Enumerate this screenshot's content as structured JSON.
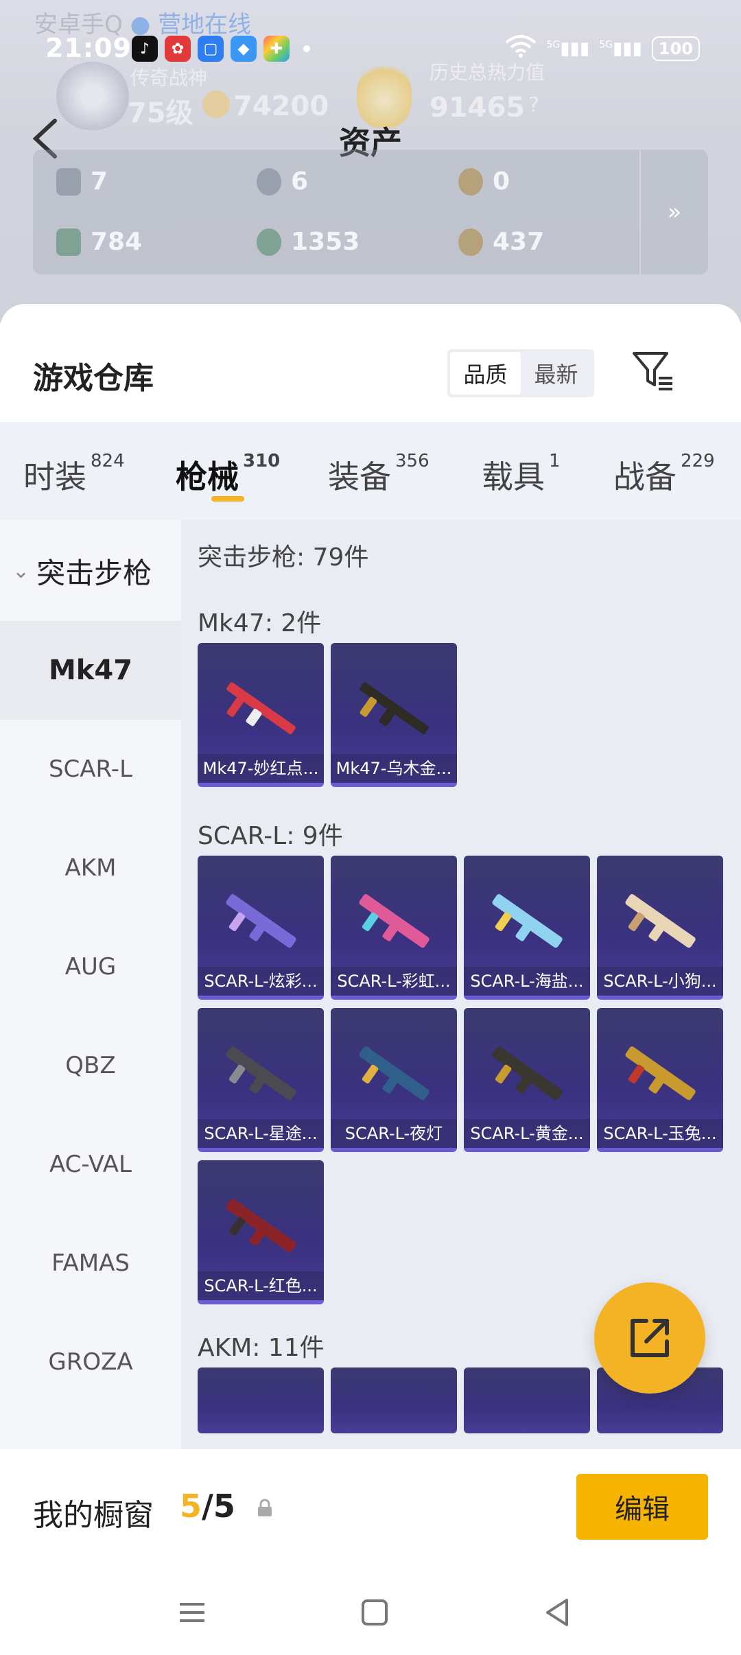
{
  "watermark": {
    "prefix": "安卓手Q",
    "online": "营地在线"
  },
  "status_bar": {
    "time": "21:09",
    "signal1": "5G",
    "signal2": "5G",
    "battery": "100"
  },
  "profile": {
    "rank_label": "传奇战神",
    "level": "75级",
    "points": "74200",
    "heat_label": "历史总热力值",
    "heat_value": "91465",
    "help": "?"
  },
  "header": {
    "title": "资产",
    "back_icon": "chevron-left-icon"
  },
  "assets": {
    "row1": [
      "7",
      "6",
      "0"
    ],
    "row2": [
      "784",
      "1353",
      "437"
    ],
    "more": "»"
  },
  "warehouse": {
    "title": "游戏仓库",
    "sort_options": [
      "品质",
      "最新"
    ],
    "active_sort": "品质"
  },
  "categories": [
    {
      "label": "时装",
      "count": "824"
    },
    {
      "label": "枪械",
      "count": "310"
    },
    {
      "label": "装备",
      "count": "356"
    },
    {
      "label": "载具",
      "count": "1"
    },
    {
      "label": "战备",
      "count": "229"
    }
  ],
  "active_category": "枪械",
  "sidebar": {
    "group": "突击步枪",
    "items": [
      "Mk47",
      "SCAR-L",
      "AKM",
      "AUG",
      "QBZ",
      "AC-VAL",
      "FAMAS",
      "GROZA"
    ],
    "active": "Mk47"
  },
  "content": {
    "summary": "突击步枪: 79件",
    "sections": [
      {
        "title": "Mk47: 2件",
        "items": [
          "Mk47-妙红点...",
          "Mk47-乌木金..."
        ]
      },
      {
        "title": "SCAR-L: 9件",
        "items": [
          "SCAR-L-炫彩...",
          "SCAR-L-彩虹...",
          "SCAR-L-海盐...",
          "SCAR-L-小狗...",
          "SCAR-L-星途...",
          "SCAR-L-夜灯",
          "SCAR-L-黄金...",
          "SCAR-L-玉兔...",
          "SCAR-L-红色..."
        ]
      },
      {
        "title": "AKM: 11件",
        "items": []
      }
    ]
  },
  "gun_colors": [
    "#d93a45",
    "#2e2a24",
    "#7a6ad8",
    "#e05a9a",
    "#8fd3f0",
    "#e8d6b6",
    "#4a4a50",
    "#2f5f8a",
    "#3a3630",
    "#c99a2e",
    "#8a2428"
  ],
  "showcase": {
    "label": "我的橱窗",
    "current": "5",
    "separator": "/",
    "total": "5",
    "edit": "编辑"
  },
  "accent_color": "#f4b324"
}
